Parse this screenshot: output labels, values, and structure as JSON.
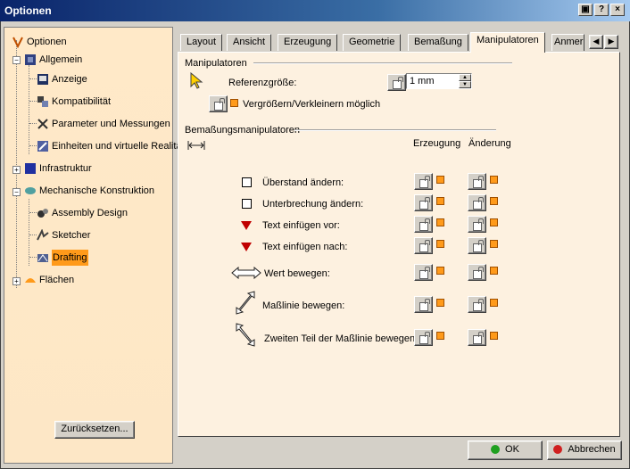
{
  "window": {
    "title": "Optionen",
    "title_buttons": [
      "▣",
      "?",
      "×"
    ]
  },
  "tree": {
    "items": [
      {
        "label": "Optionen",
        "icon": "options-icon"
      },
      {
        "label": "Allgemein",
        "icon": "general-icon"
      },
      {
        "label": "Anzeige",
        "icon": "display-icon"
      },
      {
        "label": "Kompatibilität",
        "icon": "compatibility-icon"
      },
      {
        "label": "Parameter und Messungen",
        "icon": "parameters-icon"
      },
      {
        "label": "Einheiten und virtuelle Realitä",
        "icon": "units-icon"
      },
      {
        "label": "Infrastruktur",
        "icon": "infrastructure-icon"
      },
      {
        "label": "Mechanische Konstruktion",
        "icon": "mechanical-design-icon"
      },
      {
        "label": "Assembly Design",
        "icon": "assembly-icon"
      },
      {
        "label": "Sketcher",
        "icon": "sketcher-icon"
      },
      {
        "label": "Drafting",
        "icon": "drafting-icon"
      },
      {
        "label": "Flächen",
        "icon": "surfaces-icon"
      }
    ],
    "reset_label": "Zurücksetzen..."
  },
  "tabs": [
    "Layout",
    "Ansicht",
    "Erzeugung",
    "Geometrie",
    "Bemaßung",
    "Manipulatoren",
    "Anmer"
  ],
  "active_tab": "Manipulatoren",
  "manipulators": {
    "group_label": "Manipulatoren",
    "ref_size_label": "Referenzgröße:",
    "ref_size_value": "1 mm",
    "zoom_label": "Vergrößern/Verkleinern möglich"
  },
  "dimension_manipulators": {
    "group_label": "Bemaßungsmanipulatoren",
    "col_creation": "Erzeugung",
    "col_modification": "Änderung",
    "rows": [
      {
        "label": "Überstand ändern:",
        "icon": "checkbox-icon"
      },
      {
        "label": "Unterbrechung ändern:",
        "icon": "checkbox-icon"
      },
      {
        "label": "Text einfügen vor:",
        "icon": "red-triangle-icon"
      },
      {
        "label": "Text einfügen nach:",
        "icon": "red-triangle-icon"
      },
      {
        "label": "Wert bewegen:",
        "icon": "horizontal-arrow-icon"
      },
      {
        "label": "Maßlinie bewegen:",
        "icon": "diagonal-arrow-icon"
      },
      {
        "label": "Zweiten Teil der Maßlinie bewegen:",
        "icon": "diagonal-arrow-icon"
      }
    ]
  },
  "footer": {
    "ok_label": "OK",
    "cancel_label": "Abbrechen"
  },
  "colors": {
    "accent": "#ff9a1a",
    "panel_bg": "#fdf1e0",
    "titlebar": "#0a246a"
  }
}
